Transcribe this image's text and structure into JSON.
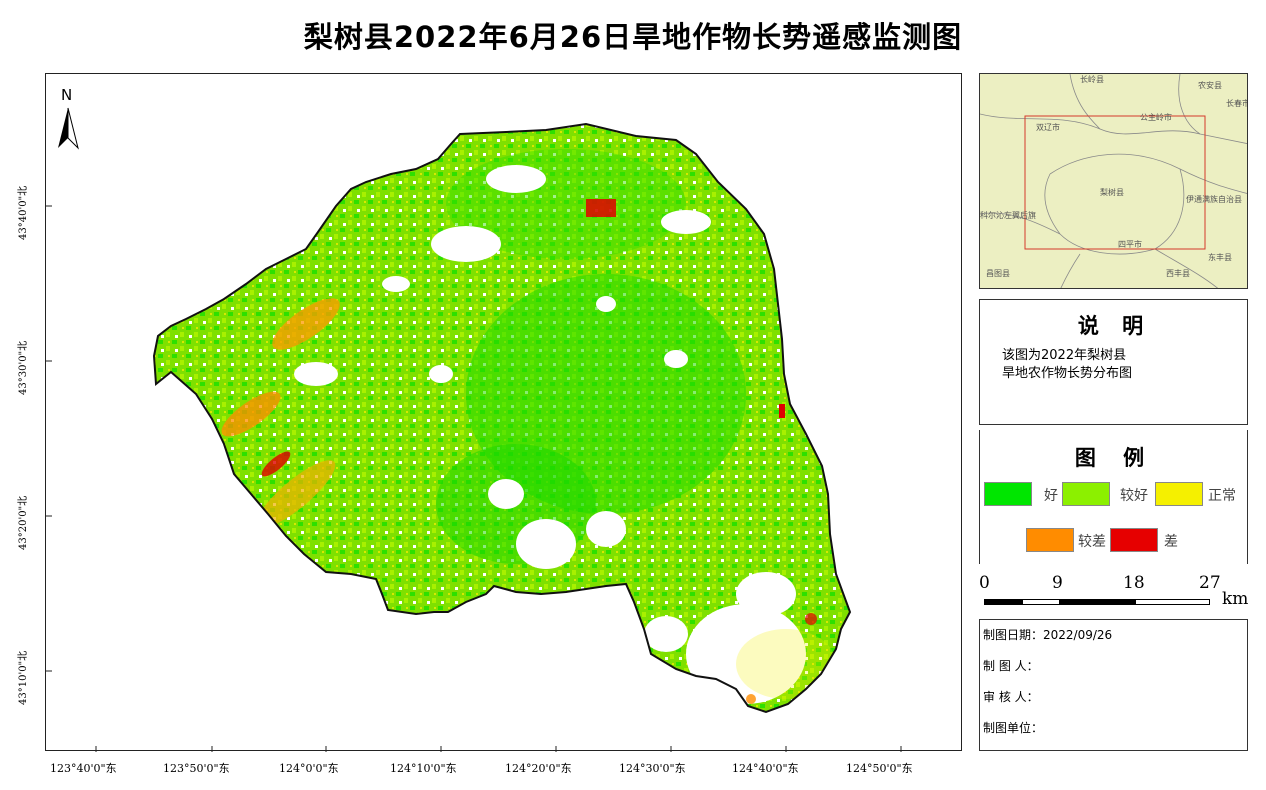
{
  "title": "梨树县2022年6月26日旱地作物长势遥感监测图",
  "north_label": "N",
  "lat_labels": [
    "43°40'0\"北",
    "43°30'0\"北",
    "43°20'0\"北",
    "43°10'0\"北"
  ],
  "lon_labels": [
    "123°40'0\"东",
    "123°50'0\"东",
    "124°0'0\"东",
    "124°10'0\"东",
    "124°20'0\"东",
    "124°30'0\"东",
    "124°40'0\"东",
    "124°50'0\"东"
  ],
  "inset": {
    "labels": [
      "长岭县",
      "农安县",
      "长春市",
      "双辽市",
      "公主岭市",
      "梨树县",
      "四平市",
      "伊通满族自治县",
      "东丰县",
      "科尔沁左翼后旗",
      "昌图县",
      "西丰县"
    ]
  },
  "description": {
    "heading": "说 明",
    "line1": "该图为2022年梨树县",
    "line2": "旱地农作物长势分布图"
  },
  "legend": {
    "heading": "图 例",
    "items": [
      {
        "label": "好",
        "color": "#00e600"
      },
      {
        "label": "较好",
        "color": "#8cf000"
      },
      {
        "label": "正常",
        "color": "#f5f000"
      },
      {
        "label": "较差",
        "color": "#ff8c00"
      },
      {
        "label": "差",
        "color": "#e60000"
      }
    ]
  },
  "scale": {
    "ticks": [
      "0",
      "9",
      "18",
      "27"
    ],
    "unit": "km"
  },
  "info": {
    "date": "制图日期：2022/09/26",
    "maker": "制  图  人：",
    "reviewer": "审  核  人：",
    "unit": "制图单位："
  }
}
